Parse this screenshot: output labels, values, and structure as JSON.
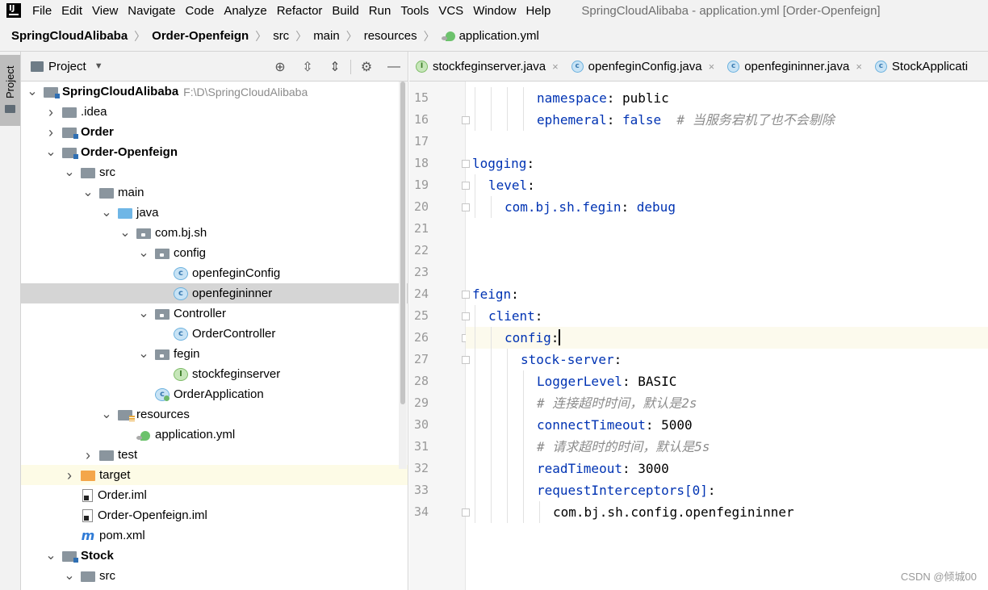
{
  "menubar": {
    "logo_text": "IJ",
    "items": [
      "File",
      "Edit",
      "View",
      "Navigate",
      "Code",
      "Analyze",
      "Refactor",
      "Build",
      "Run",
      "Tools",
      "VCS",
      "Window",
      "Help"
    ],
    "window_title": "SpringCloudAlibaba - application.yml [Order-Openfeign]"
  },
  "breadcrumb": [
    "SpringCloudAlibaba",
    "Order-Openfeign",
    "src",
    "main",
    "resources",
    "application.yml"
  ],
  "toolstrip": {
    "project_label": "Project"
  },
  "project_panel": {
    "title": "Project",
    "tools": [
      "locate-icon",
      "expand-all-icon",
      "collapse-all-icon",
      "gear-icon",
      "minimize-icon"
    ],
    "tree": [
      {
        "label": "SpringCloudAlibaba",
        "path": "F:\\D\\SpringCloudAlibaba",
        "depth": 0,
        "arrow": "down",
        "icon": "module-folder",
        "bold": true
      },
      {
        "label": ".idea",
        "depth": 1,
        "arrow": "right",
        "icon": "folder"
      },
      {
        "label": "Order",
        "depth": 1,
        "arrow": "right",
        "icon": "module-folder",
        "bold": true
      },
      {
        "label": "Order-Openfeign",
        "depth": 1,
        "arrow": "down",
        "icon": "module-folder",
        "bold": true
      },
      {
        "label": "src",
        "depth": 2,
        "arrow": "down",
        "icon": "folder"
      },
      {
        "label": "main",
        "depth": 3,
        "arrow": "down",
        "icon": "folder"
      },
      {
        "label": "java",
        "depth": 4,
        "arrow": "down",
        "icon": "source-folder"
      },
      {
        "label": "com.bj.sh",
        "depth": 5,
        "arrow": "down",
        "icon": "package"
      },
      {
        "label": "config",
        "depth": 6,
        "arrow": "down",
        "icon": "package"
      },
      {
        "label": "openfeginConfig",
        "depth": 7,
        "arrow": "none",
        "icon": "class"
      },
      {
        "label": "openfegininner",
        "depth": 7,
        "arrow": "none",
        "icon": "class",
        "selected": true
      },
      {
        "label": "Controller",
        "depth": 6,
        "arrow": "down",
        "icon": "package"
      },
      {
        "label": "OrderController",
        "depth": 7,
        "arrow": "none",
        "icon": "class"
      },
      {
        "label": "fegin",
        "depth": 6,
        "arrow": "down",
        "icon": "package"
      },
      {
        "label": "stockfeginserver",
        "depth": 7,
        "arrow": "none",
        "icon": "interface"
      },
      {
        "label": "OrderApplication",
        "depth": 6,
        "arrow": "none",
        "icon": "app-class"
      },
      {
        "label": "resources",
        "depth": 4,
        "arrow": "down",
        "icon": "resources-folder"
      },
      {
        "label": "application.yml",
        "depth": 5,
        "arrow": "none",
        "icon": "yml"
      },
      {
        "label": "test",
        "depth": 3,
        "arrow": "right",
        "icon": "folder"
      },
      {
        "label": "target",
        "depth": 2,
        "arrow": "right",
        "icon": "excluded-folder",
        "highlight": true
      },
      {
        "label": "Order.iml",
        "depth": 2,
        "arrow": "none",
        "icon": "iml"
      },
      {
        "label": "Order-Openfeign.iml",
        "depth": 2,
        "arrow": "none",
        "icon": "iml"
      },
      {
        "label": "pom.xml",
        "depth": 2,
        "arrow": "none",
        "icon": "maven"
      },
      {
        "label": "Stock",
        "depth": 1,
        "arrow": "down",
        "icon": "module-folder",
        "bold": true
      },
      {
        "label": "src",
        "depth": 2,
        "arrow": "down",
        "icon": "folder"
      }
    ]
  },
  "tabs": [
    {
      "label": "stockfeginserver.java",
      "icon": "interface"
    },
    {
      "label": "openfeginConfig.java",
      "icon": "class"
    },
    {
      "label": "openfegininner.java",
      "icon": "class"
    },
    {
      "label": "StockApplicati",
      "icon": "app-class"
    }
  ],
  "editor": {
    "lines": [
      {
        "n": "15",
        "indent": 4,
        "key": "namespace",
        "value": "public"
      },
      {
        "n": "16",
        "indent": 4,
        "key": "ephemeral",
        "value": "false",
        "comment": "  # 当服务宕机了也不会剔除",
        "fold": true
      },
      {
        "n": "17",
        "indent": 0
      },
      {
        "n": "18",
        "indent": 0,
        "key": "logging",
        "fold": true
      },
      {
        "n": "19",
        "indent": 1,
        "key": "level",
        "fold": true
      },
      {
        "n": "20",
        "indent": 2,
        "key": "com.bj.sh.fegin",
        "value": "debug",
        "fold": true
      },
      {
        "n": "21",
        "indent": 0
      },
      {
        "n": "22",
        "indent": 0
      },
      {
        "n": "23",
        "indent": 0
      },
      {
        "n": "24",
        "indent": 0,
        "key": "feign",
        "fold": true
      },
      {
        "n": "25",
        "indent": 1,
        "key": "client",
        "fold": true
      },
      {
        "n": "26",
        "indent": 2,
        "key": "config",
        "fold": true,
        "current": true
      },
      {
        "n": "27",
        "indent": 3,
        "key": "stock-server",
        "fold": true
      },
      {
        "n": "28",
        "indent": 4,
        "key": "LoggerLevel",
        "value": "BASIC"
      },
      {
        "n": "29",
        "indent": 4,
        "comment": "# 连接超时时间，默认是2s"
      },
      {
        "n": "30",
        "indent": 4,
        "key": "connectTimeout",
        "value": "5000"
      },
      {
        "n": "31",
        "indent": 4,
        "comment": "# 请求超时的时间，默认是5s"
      },
      {
        "n": "32",
        "indent": 4,
        "key": "readTimeout",
        "value": "3000"
      },
      {
        "n": "33",
        "indent": 4,
        "key": "requestInterceptors[0]"
      },
      {
        "n": "34",
        "indent": 5,
        "plain": "com.bj.sh.config.openfegininner",
        "fold": true
      }
    ]
  },
  "watermark": "CSDN @倾城00",
  "colors": {
    "key": "#0033b3",
    "value": "#067d17",
    "comment": "#8c8c8c",
    "selection": "#d5d5d5"
  }
}
